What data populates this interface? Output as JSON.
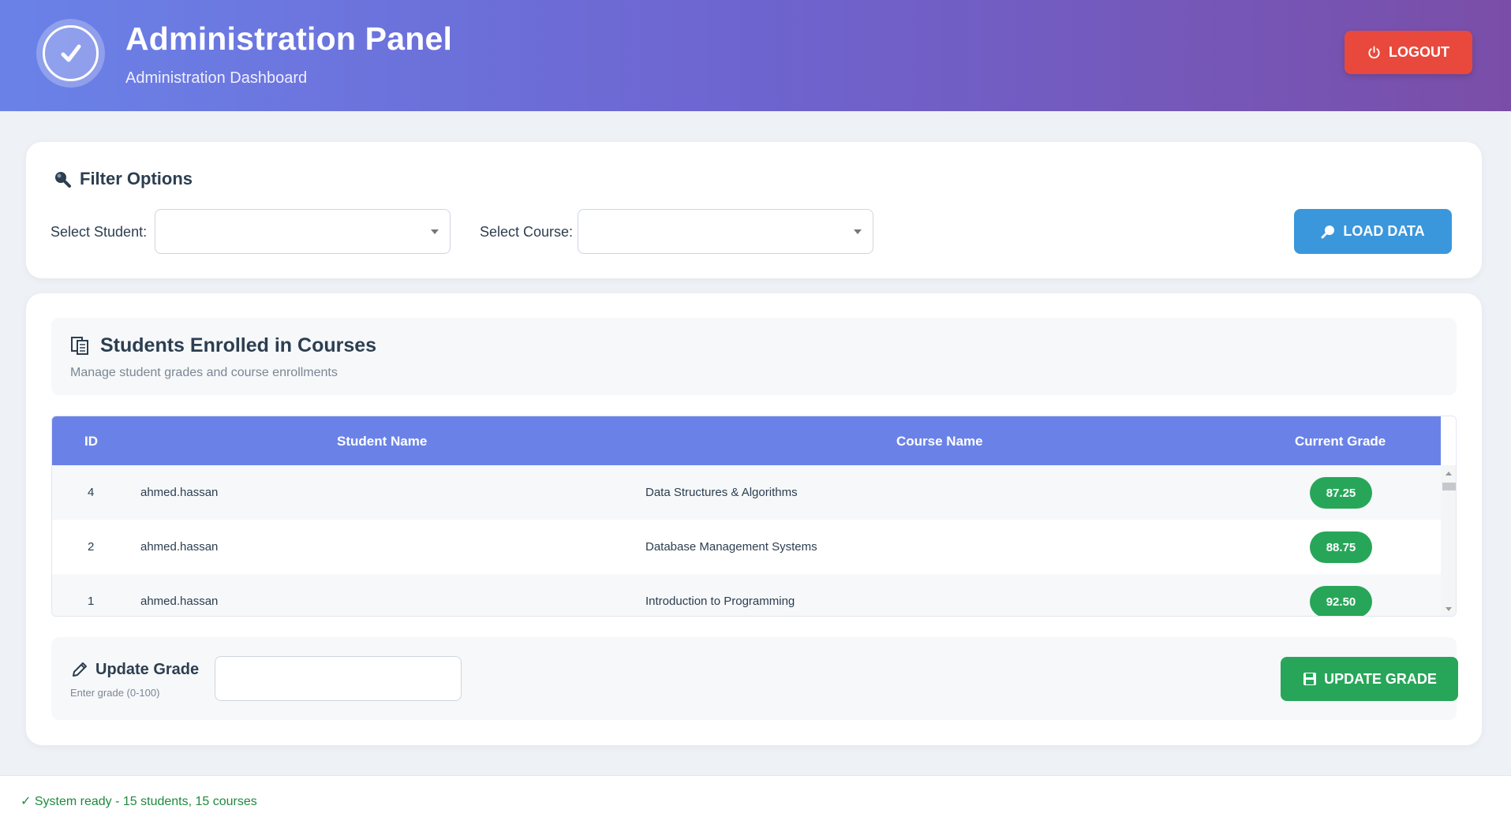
{
  "header": {
    "title": "Administration Panel",
    "subtitle": "Administration Dashboard",
    "logout_label": "LOGOUT"
  },
  "filter": {
    "title": "Filter Options",
    "student_label": "Select Student:",
    "course_label": "Select Course:",
    "student_value": "",
    "course_value": "",
    "load_label": "LOAD DATA"
  },
  "enrollments": {
    "title": "Students Enrolled in Courses",
    "description": "Manage student grades and course enrollments",
    "columns": [
      "ID",
      "Student Name",
      "Course Name",
      "Current Grade"
    ],
    "rows": [
      {
        "id": "4",
        "student": "ahmed.hassan",
        "course": "Data Structures & Algorithms",
        "grade": "87.25"
      },
      {
        "id": "2",
        "student": "ahmed.hassan",
        "course": "Database Management Systems",
        "grade": "88.75"
      },
      {
        "id": "1",
        "student": "ahmed.hassan",
        "course": "Introduction to Programming",
        "grade": "92.50"
      }
    ]
  },
  "update": {
    "title": "Update Grade",
    "hint": "Enter grade (0-100)",
    "input_value": "",
    "button_label": "UPDATE GRADE"
  },
  "status": {
    "text": "✓ System ready - 15 students, 15 courses"
  },
  "colors": {
    "header_start": "#6a82e8",
    "header_end": "#7a4ea8",
    "logout": "#e8493c",
    "primary": "#3a97dc",
    "success": "#27a659",
    "table_header": "#6a82e8"
  }
}
